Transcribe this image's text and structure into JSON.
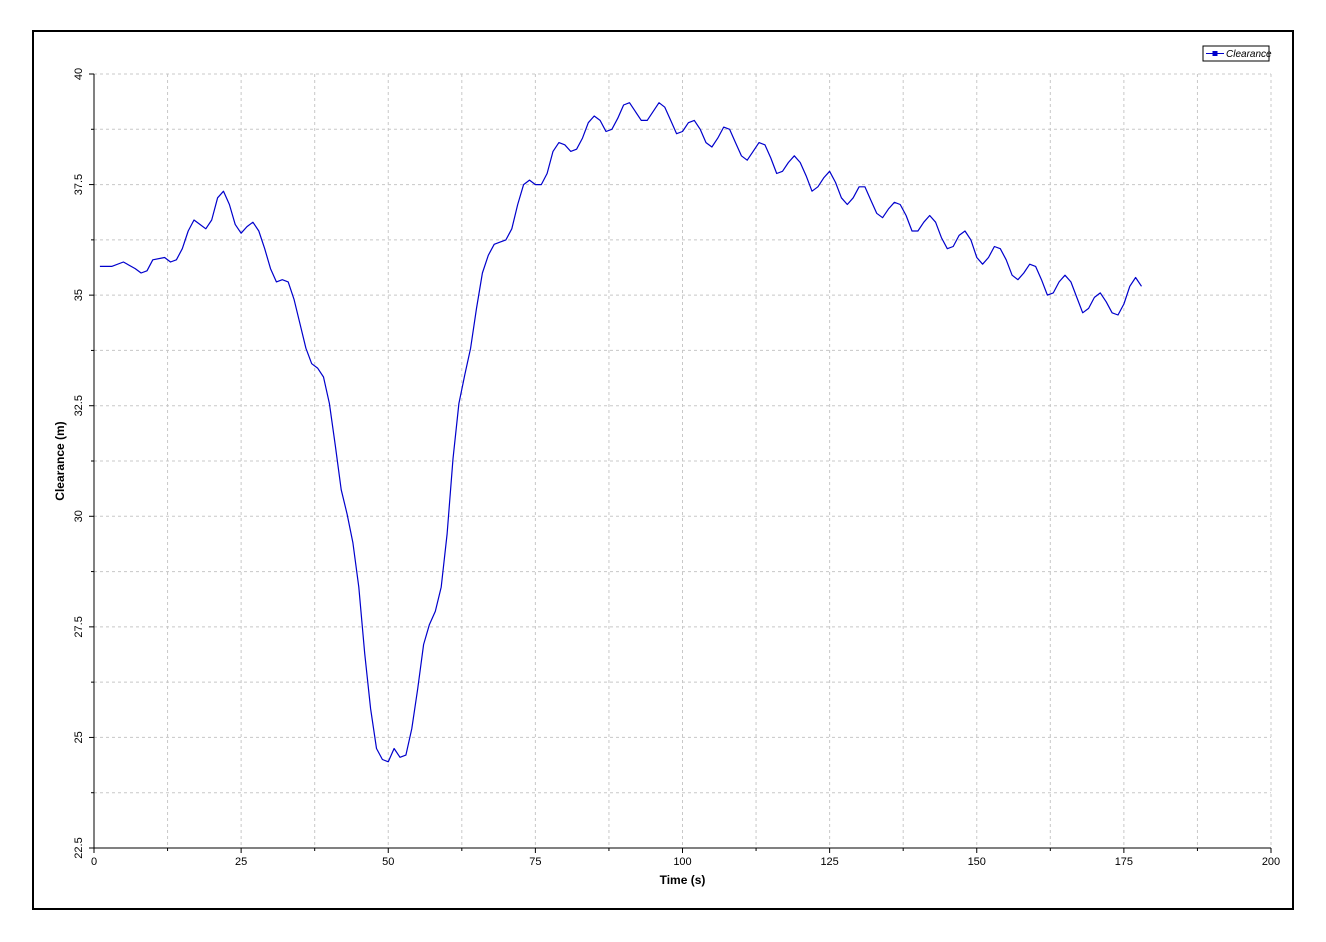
{
  "chart_data": {
    "type": "line",
    "xlabel": "Time (s)",
    "ylabel": "Clearance (m)",
    "xlim": [
      0,
      200
    ],
    "ylim": [
      22.5,
      40
    ],
    "x_ticks": [
      0,
      25,
      50,
      75,
      100,
      125,
      150,
      175,
      200
    ],
    "x_tick_labels": [
      "0",
      "25",
      "50",
      "75",
      "100",
      "125",
      "150",
      "175",
      "200"
    ],
    "y_ticks": [
      22.5,
      25,
      27.5,
      30,
      32.5,
      35,
      37.5,
      40
    ],
    "y_tick_labels": [
      "22.5",
      "25",
      "27.5",
      "30",
      "32.5",
      "35",
      "37.5",
      "40"
    ],
    "grid": true,
    "legend_position": "top-right",
    "series": [
      {
        "name": "Clearance",
        "color": "#0000cc",
        "x": [
          1,
          3,
          5,
          7,
          8,
          9,
          10,
          12,
          13,
          14,
          15,
          16,
          17,
          18,
          19,
          20,
          21,
          22,
          23,
          24,
          25,
          26,
          27,
          28,
          29,
          30,
          31,
          32,
          33,
          34,
          35,
          36,
          37,
          38,
          39,
          40,
          41,
          42,
          43,
          44,
          45,
          46,
          47,
          48,
          49,
          50,
          51,
          52,
          53,
          54,
          55,
          56,
          57,
          58,
          59,
          60,
          61,
          62,
          63,
          64,
          65,
          66,
          67,
          68,
          69,
          70,
          71,
          72,
          73,
          74,
          75,
          76,
          77,
          78,
          79,
          80,
          81,
          82,
          83,
          84,
          85,
          86,
          87,
          88,
          89,
          90,
          91,
          92,
          93,
          94,
          95,
          96,
          97,
          98,
          99,
          100,
          101,
          102,
          103,
          104,
          105,
          106,
          107,
          108,
          109,
          110,
          111,
          112,
          113,
          114,
          115,
          116,
          117,
          118,
          119,
          120,
          121,
          122,
          123,
          124,
          125,
          126,
          127,
          128,
          129,
          130,
          131,
          132,
          133,
          134,
          135,
          136,
          137,
          138,
          139,
          140,
          141,
          142,
          143,
          144,
          145,
          146,
          147,
          148,
          149,
          150,
          151,
          152,
          153,
          154,
          155,
          156,
          157,
          158,
          159,
          160,
          161,
          162,
          163,
          164,
          165,
          166,
          167,
          168,
          169,
          170,
          171,
          172,
          173,
          174,
          175,
          176,
          177,
          178
        ],
        "y": [
          35.65,
          35.65,
          35.75,
          35.6,
          35.5,
          35.55,
          35.8,
          35.85,
          35.75,
          35.8,
          36.05,
          36.45,
          36.7,
          36.6,
          36.5,
          36.7,
          37.2,
          37.35,
          37.05,
          36.6,
          36.4,
          36.55,
          36.65,
          36.45,
          36.05,
          35.6,
          35.3,
          35.35,
          35.3,
          34.9,
          34.35,
          33.8,
          33.45,
          33.35,
          33.15,
          32.55,
          31.6,
          30.6,
          30.05,
          29.4,
          28.4,
          26.9,
          25.65,
          24.75,
          24.5,
          24.45,
          24.75,
          24.55,
          24.6,
          25.2,
          26.1,
          27.1,
          27.55,
          27.85,
          28.4,
          29.6,
          31.3,
          32.55,
          33.2,
          33.8,
          34.7,
          35.5,
          35.9,
          36.15,
          36.2,
          36.25,
          36.5,
          37.05,
          37.5,
          37.6,
          37.5,
          37.5,
          37.75,
          38.25,
          38.45,
          38.4,
          38.25,
          38.3,
          38.55,
          38.9,
          39.05,
          38.95,
          38.7,
          38.75,
          39.0,
          39.3,
          39.35,
          39.15,
          38.95,
          38.95,
          39.15,
          39.35,
          39.25,
          38.95,
          38.65,
          38.7,
          38.9,
          38.95,
          38.75,
          38.45,
          38.35,
          38.55,
          38.8,
          38.75,
          38.45,
          38.15,
          38.05,
          38.25,
          38.45,
          38.4,
          38.1,
          37.75,
          37.8,
          38.0,
          38.15,
          38.0,
          37.7,
          37.35,
          37.45,
          37.65,
          37.8,
          37.55,
          37.2,
          37.05,
          37.2,
          37.45,
          37.45,
          37.15,
          36.85,
          36.75,
          36.95,
          37.1,
          37.05,
          36.8,
          36.45,
          36.45,
          36.65,
          36.8,
          36.65,
          36.3,
          36.05,
          36.1,
          36.35,
          36.45,
          36.25,
          35.85,
          35.7,
          35.85,
          36.1,
          36.05,
          35.8,
          35.45,
          35.35,
          35.5,
          35.7,
          35.65,
          35.35,
          35.0,
          35.05,
          35.3,
          35.45,
          35.3,
          34.95,
          34.6,
          34.7,
          34.95,
          35.05,
          34.85,
          34.6,
          34.55,
          34.8,
          35.2,
          35.4,
          35.2
        ]
      }
    ]
  }
}
